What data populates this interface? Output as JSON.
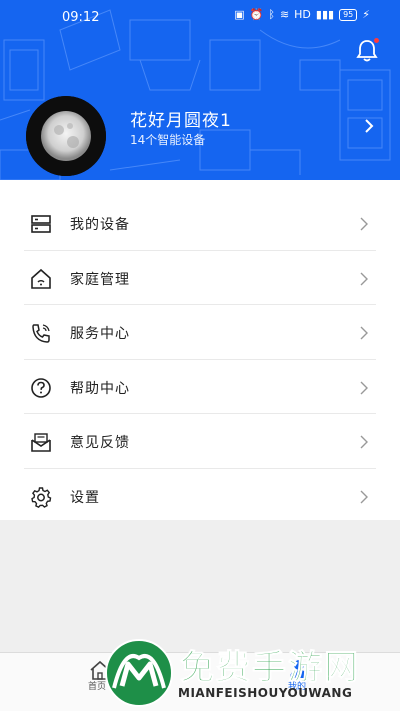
{
  "status_bar": {
    "time": "09:12",
    "icons": [
      "nfc-icon",
      "alarm-icon",
      "bluetooth-icon",
      "wifi-icon",
      "hd-icon",
      "signal-icon"
    ],
    "battery": "95"
  },
  "header": {
    "user_name": "花好月圆夜1",
    "device_count": "14个智能设备",
    "background_color": "#1565f0",
    "notification_badge": true
  },
  "menu": {
    "items": [
      {
        "label": "我的设备",
        "icon": "device-server-icon"
      },
      {
        "label": "家庭管理",
        "icon": "home-icon"
      },
      {
        "label": "服务中心",
        "icon": "phone-service-icon"
      },
      {
        "label": "帮助中心",
        "icon": "help-icon"
      },
      {
        "label": "意见反馈",
        "icon": "feedback-mail-icon"
      },
      {
        "label": "设置",
        "icon": "settings-gear-icon"
      }
    ]
  },
  "bottom_nav": {
    "home_label": "首页",
    "mine_label": "我的",
    "active_color": "#1565f0"
  },
  "watermark": {
    "title": "免费手游网",
    "subtitle": "MIANFEISHOUYOUWANG"
  }
}
